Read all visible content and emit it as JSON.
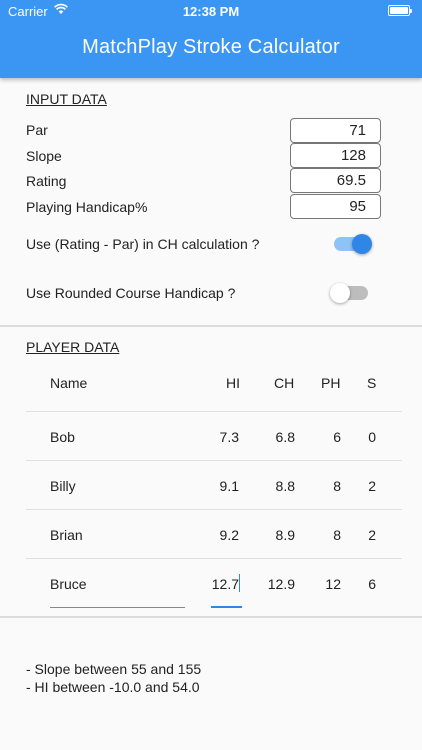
{
  "status_bar": {
    "carrier": "Carrier",
    "time": "12:38 PM"
  },
  "app_title": "MatchPlay Stroke Calculator",
  "input_section": {
    "title": "INPUT DATA",
    "fields": [
      {
        "label": "Par",
        "value": "71"
      },
      {
        "label": "Slope",
        "value": "128"
      },
      {
        "label": "Rating",
        "value": "69.5"
      },
      {
        "label": "Playing Handicap%",
        "value": "95"
      }
    ],
    "toggles": [
      {
        "label": "Use (Rating - Par) in CH calculation ?",
        "on": true
      },
      {
        "label": "Use Rounded Course Handicap ?",
        "on": false
      }
    ]
  },
  "player_section": {
    "title": "PLAYER DATA",
    "columns": {
      "name": "Name",
      "hi": "HI",
      "ch": "CH",
      "ph": "PH",
      "s": "S"
    },
    "players": [
      {
        "name": "Bob",
        "hi": "7.3",
        "ch": "6.8",
        "ph": "6",
        "s": "0"
      },
      {
        "name": "Billy",
        "hi": "9.1",
        "ch": "8.8",
        "ph": "8",
        "s": "2"
      },
      {
        "name": "Brian",
        "hi": "9.2",
        "ch": "8.9",
        "ph": "8",
        "s": "2"
      },
      {
        "name": "Bruce",
        "hi": "12.7",
        "ch": "12.9",
        "ph": "12",
        "s": "6"
      }
    ],
    "focused_row": "Bruce"
  },
  "notes": [
    "- Slope between 55 and 155",
    "- HI between -10.0 and 54.0"
  ],
  "colors": {
    "primary": "#3b95f3",
    "accent": "#2e86e6"
  }
}
